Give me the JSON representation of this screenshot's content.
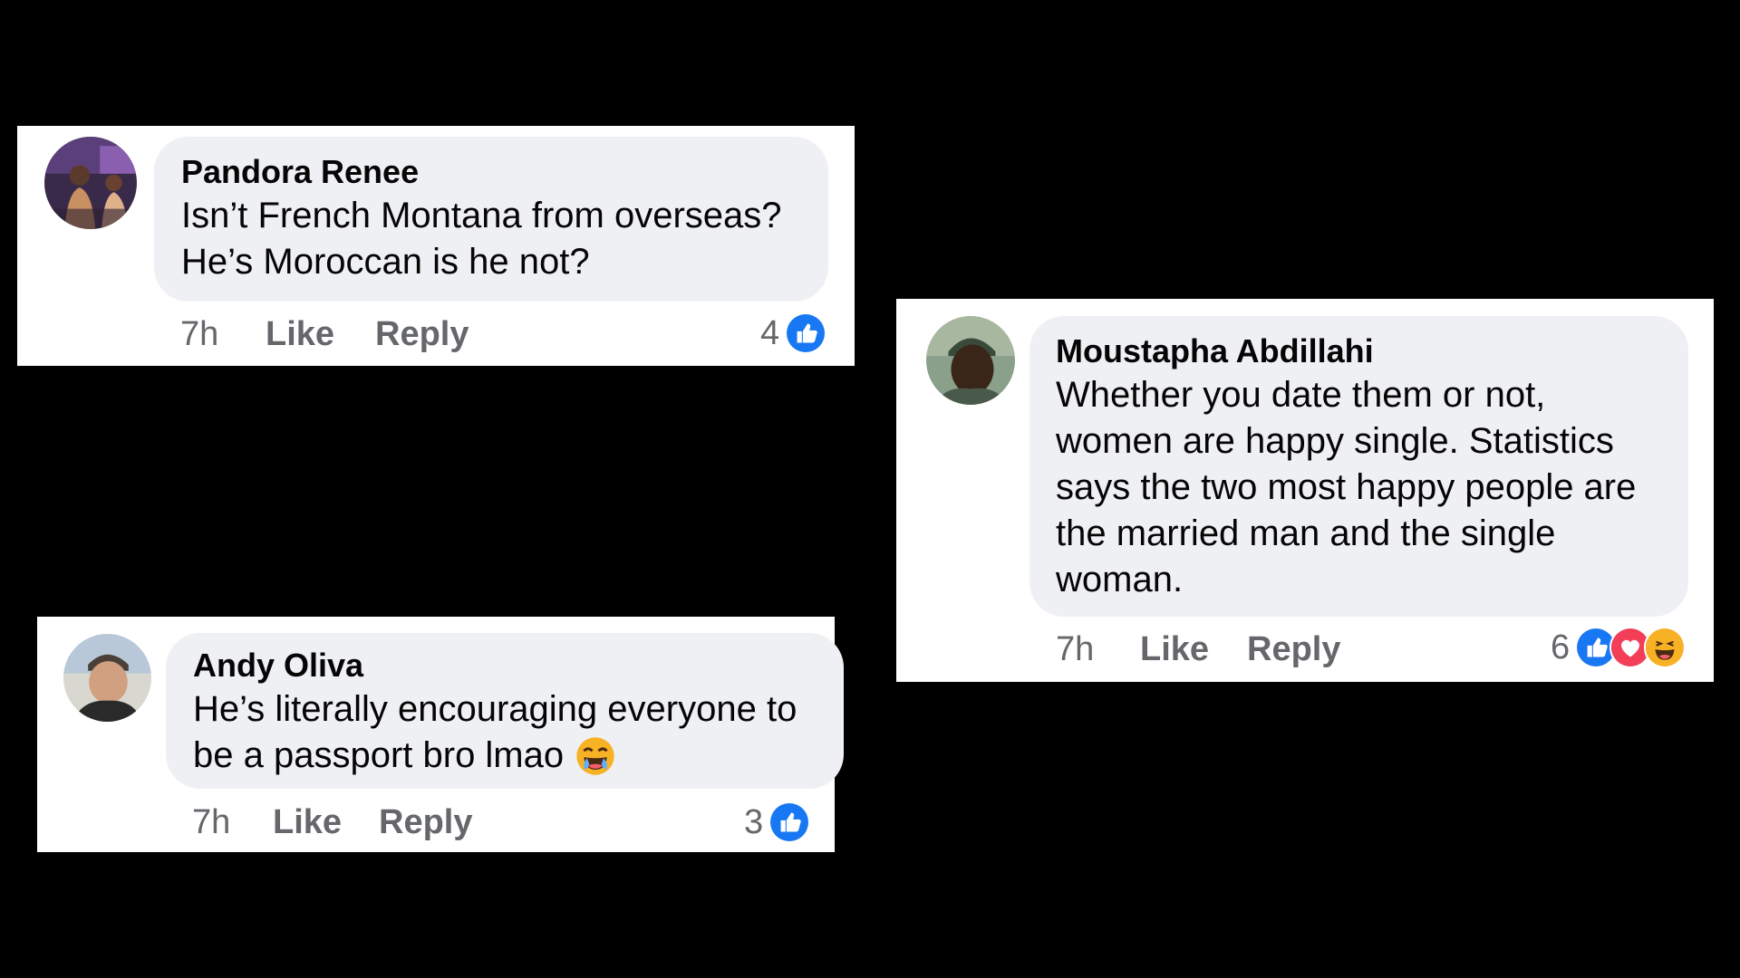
{
  "comments": [
    {
      "author": "Pandora Renee",
      "text_lines": [
        "Isn’t French Montana from overseas?",
        "He’s Moroccan is he not?"
      ],
      "time": "7h",
      "like_label": "Like",
      "reply_label": "Reply",
      "reaction_count": "4",
      "reactions": [
        "like-icon"
      ]
    },
    {
      "author": "Moustapha Abdillahi",
      "text_lines": [
        "Whether you date them or not,",
        "women are happy single. Statistics",
        "says the two most happy people are",
        "the married man and the single",
        "woman."
      ],
      "time": "7h",
      "like_label": "Like",
      "reply_label": "Reply",
      "reaction_count": "6",
      "reactions": [
        "like-icon",
        "love-icon",
        "haha-icon"
      ]
    },
    {
      "author": "Andy Oliva",
      "text_lines": [
        "He’s literally encouraging everyone to",
        "be a passport bro lmao"
      ],
      "inline_emoji": "laughing-tears-emoji",
      "time": "7h",
      "like_label": "Like",
      "reply_label": "Reply",
      "reaction_count": "3",
      "reactions": [
        "like-icon"
      ]
    }
  ],
  "colors": {
    "background": "#000000",
    "card": "#ffffff",
    "bubble": "#eff0f3",
    "meta_text": "#65676b",
    "like_blue": "#1877f2",
    "love_red": "#f33e58",
    "haha_yellow": "#f7b125"
  }
}
